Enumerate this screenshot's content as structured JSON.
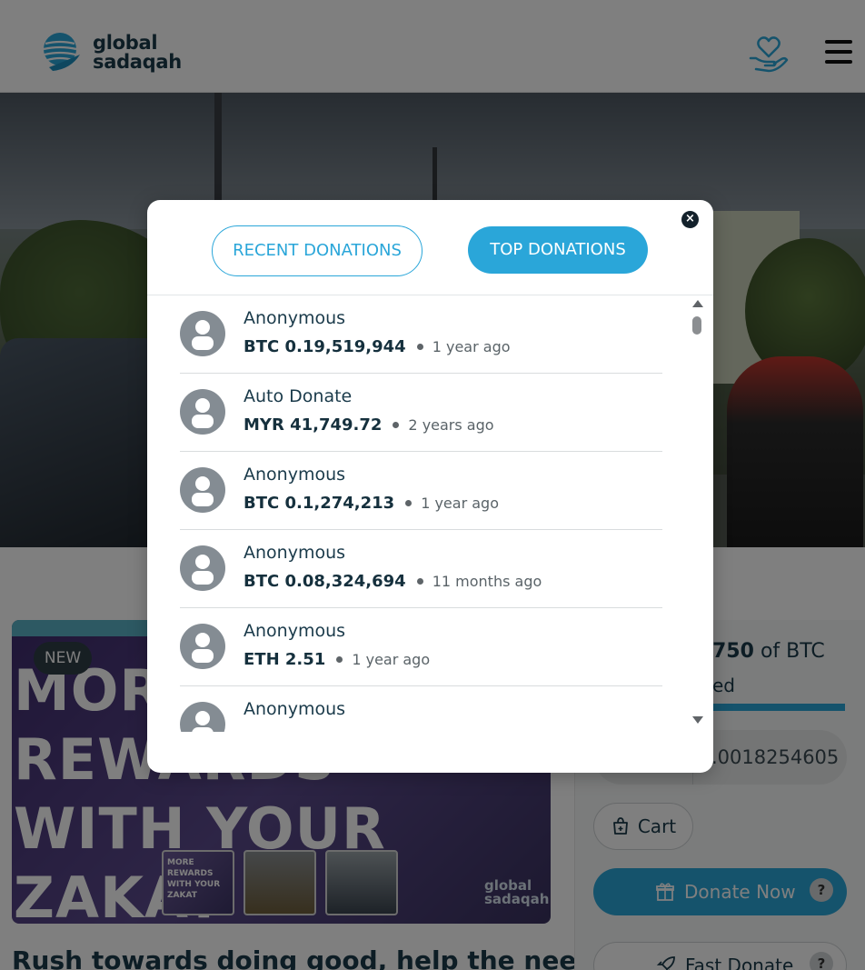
{
  "header": {
    "logo_line1": "global",
    "logo_line2": "sadaqah"
  },
  "promo": {
    "badge": "NEW",
    "lines": [
      "MORE",
      "REWARDS",
      "WITH YOUR",
      "ZAKAT"
    ],
    "thumb1_text": "MORE REWARDS WITH YOUR ZAKAT",
    "watermark_line1": "global",
    "watermark_line2": "sadaqah"
  },
  "headline": "Rush towards doing good, help the needy",
  "side_panel": {
    "raised_value": "750",
    "raised_unit": "of BTC",
    "raised_sub": "ed",
    "progress_fraction": 1.0,
    "amount_value": ".0018254605",
    "cart_label": "Cart",
    "donate_label": "Donate Now",
    "help_mark": "?",
    "fast_donate_label": "Fast Donate"
  },
  "modal": {
    "close_glyph": "×",
    "tabs": [
      {
        "label": "RECENT DONATIONS",
        "active": false
      },
      {
        "label": "TOP DONATIONS",
        "active": true
      }
    ],
    "donations": [
      {
        "name": "Anonymous",
        "amount": "BTC 0.19,519,944",
        "time": "1 year ago"
      },
      {
        "name": "Auto Donate",
        "amount": "MYR 41,749.72",
        "time": "2 years ago"
      },
      {
        "name": "Anonymous",
        "amount": "BTC 0.1,274,213",
        "time": "1 year ago"
      },
      {
        "name": "Anonymous",
        "amount": "BTC 0.08,324,694",
        "time": "11 months ago"
      },
      {
        "name": "Anonymous",
        "amount": "ETH 2.51",
        "time": "1 year ago"
      },
      {
        "name": "Anonymous",
        "amount": "",
        "time": ""
      }
    ]
  },
  "colors": {
    "accent": "#2aa6d9",
    "text_dark": "#1a3a4a",
    "overlay": "rgba(0,0,0,0.5)"
  }
}
